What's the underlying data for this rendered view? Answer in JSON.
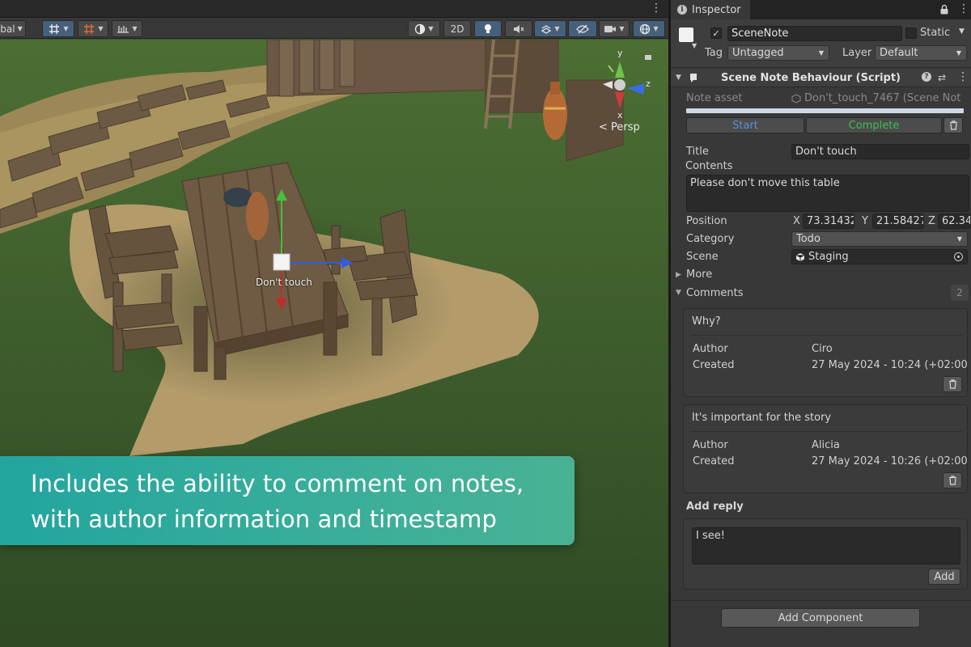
{
  "scene": {
    "toolbar": {
      "pivot_label": "bal",
      "mode_2d_label": "2D"
    },
    "orientation_label": "< Persp",
    "gizmo_axes": {
      "y": "y",
      "z": "z",
      "x": "x"
    },
    "note_label": "Don't touch",
    "caption": "Includes the ability to comment on notes, with author information and timestamp"
  },
  "inspector": {
    "tab_label": "Inspector",
    "gameobject": {
      "name": "SceneNote",
      "static_label": "Static",
      "tag_label": "Tag",
      "tag_value": "Untagged",
      "layer_label": "Layer",
      "layer_value": "Default"
    },
    "component": {
      "title": "Scene Note Behaviour (Script)",
      "note_asset_label": "Note asset",
      "note_asset_value": "Don't_touch_7467 (Scene Not",
      "start_label": "Start",
      "complete_label": "Complete",
      "title_label": "Title",
      "title_value": "Don't touch",
      "contents_label": "Contents",
      "contents_value": "Please don't move this table",
      "position_label": "Position",
      "position": {
        "x_label": "X",
        "x": "73.31432",
        "y_label": "Y",
        "y": "21.58427",
        "z_label": "Z",
        "z": "62.34"
      },
      "category_label": "Category",
      "category_value": "Todo",
      "scene_label": "Scene",
      "scene_value": "Staging",
      "more_label": "More",
      "comments_label": "Comments",
      "comments_count": "2",
      "comments": [
        {
          "text": "Why?",
          "author_label": "Author",
          "author": "Ciro",
          "created_label": "Created",
          "created": "27 May 2024 - 10:24 (+02:00"
        },
        {
          "text": "It's important for the story",
          "author_label": "Author",
          "author": "Alicia",
          "created_label": "Created",
          "created": "27 May 2024 - 10:26 (+02:00"
        }
      ],
      "add_reply_label": "Add reply",
      "reply_value": "I see!",
      "add_button": "Add"
    },
    "add_component_label": "Add Component"
  },
  "colors": {
    "start": "#5a8fd8",
    "complete": "#3fbf4f",
    "caption_gradient_start": "#22a59e",
    "caption_gradient_end": "#4ab294"
  }
}
